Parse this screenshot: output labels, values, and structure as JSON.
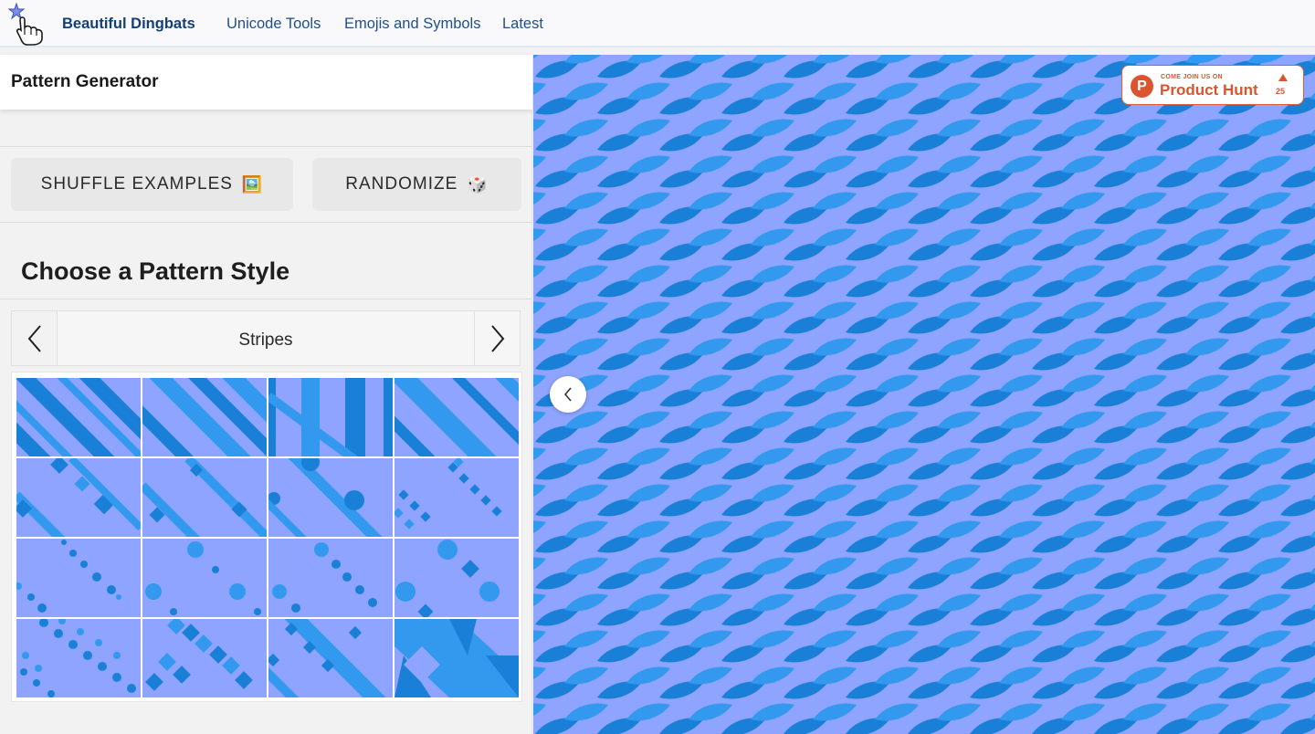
{
  "nav": {
    "brand": "Beautiful Dingbats",
    "links": [
      "Unicode Tools",
      "Emojis and Symbols",
      "Latest"
    ]
  },
  "panel": {
    "title": "Pattern Generator",
    "shuffle_label": "SHUFFLE EXAMPLES",
    "shuffle_emoji": "🖼️",
    "randomize_label": "RANDOMIZE",
    "randomize_emoji": "🎲",
    "section_title": "Choose a Pattern Style",
    "style_selector": {
      "current": "Stripes"
    }
  },
  "product_hunt": {
    "small_text": "COME JOIN US ON",
    "name": "Product Hunt",
    "votes": "25"
  },
  "colors": {
    "pattern_bg": "#8ea4ff",
    "pattern_dark": "#1a7fd6",
    "pattern_light": "#3399ee",
    "brand_blue": "#123f78",
    "product_hunt": "#da552f"
  },
  "icons": {
    "logo": "pointing-hand-logo",
    "prev": "chevron-left-icon",
    "next": "chevron-right-icon",
    "collapse": "chevron-left-icon"
  }
}
